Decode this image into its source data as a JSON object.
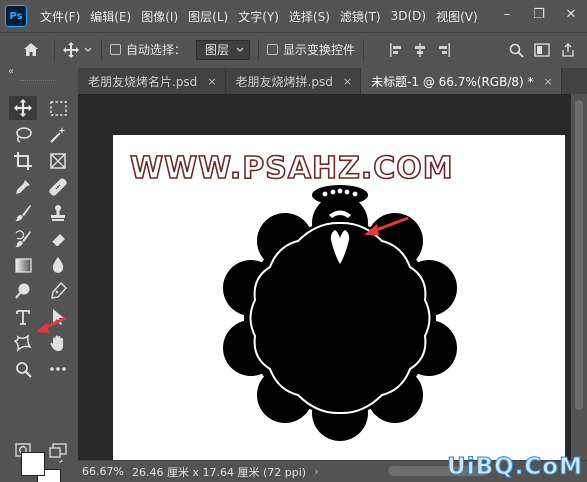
{
  "app": {
    "logo_text": "Ps"
  },
  "menu": {
    "items": [
      "文件(F)",
      "编辑(E)",
      "图像(I)",
      "图层(L)",
      "文字(Y)",
      "选择(S)",
      "滤镜(T)",
      "3D(D)",
      "视图(V)"
    ]
  },
  "window_controls": {
    "minimize": "–",
    "restore": "❐",
    "close": "✕"
  },
  "options": {
    "auto_select_label": "自动选择：",
    "auto_select_checked": false,
    "layer_select_value": "图层",
    "show_transform_label": "显示变换控件",
    "show_transform_checked": false
  },
  "tabs": [
    {
      "label": "老朋友烧烤名片.psd",
      "close": "×",
      "active": false
    },
    {
      "label": "老朋友烧烤拼.psd",
      "close": "×",
      "active": false
    },
    {
      "label": "未标题-1 @ 66.7%(RGB/8) *",
      "close": "×",
      "active": true
    }
  ],
  "toolbar": {
    "collapse": "«"
  },
  "canvas": {
    "watermark_text": "WWW.PSAHZ.COM",
    "shape_fill": "#000000",
    "arrow_color": "#e8383a"
  },
  "status": {
    "zoom": "66.67%",
    "dimensions": "26.46 厘米 x 17.64 厘米 (72 ppi)",
    "arrow": "›"
  },
  "site_watermark": "UiBQ.CoM",
  "colors": {
    "ui_bg": "#535353",
    "workspace": "#282828",
    "tab_bg": "#424242",
    "accent": "#31a8ff"
  }
}
